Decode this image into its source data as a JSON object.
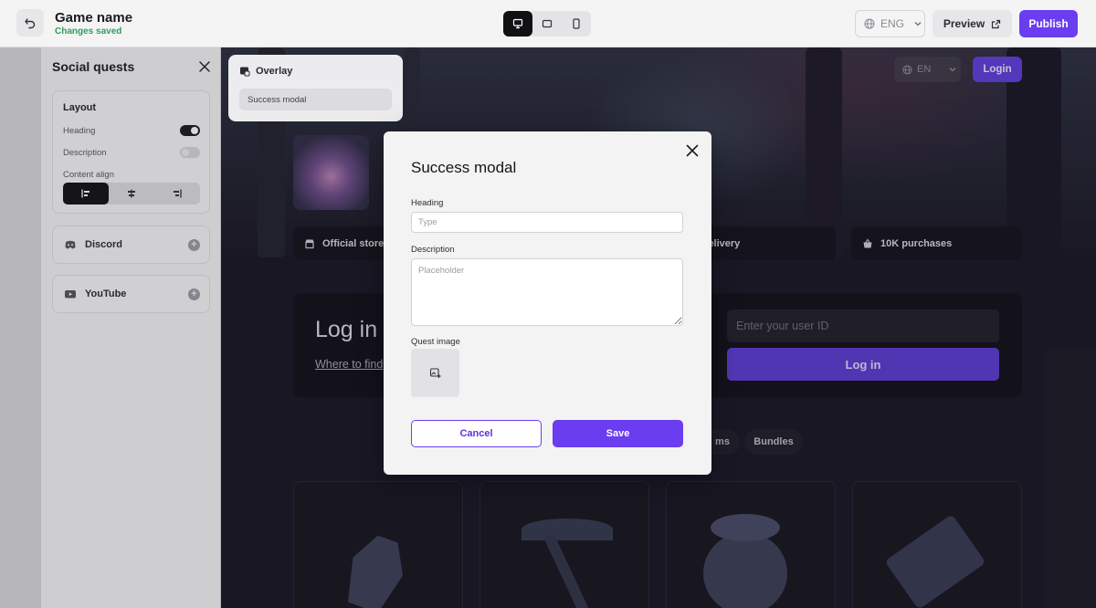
{
  "topbar": {
    "game_name": "Game name",
    "save_status": "Changes saved",
    "devices": [
      "desktop-icon",
      "tablet-icon",
      "mobile-icon"
    ],
    "active_device": "desktop",
    "language": "ENG",
    "preview_label": "Preview",
    "publish_label": "Publish"
  },
  "sidebar": {
    "title": "Social quests",
    "layout": {
      "title": "Layout",
      "heading_label": "Heading",
      "heading_enabled": true,
      "description_label": "Description",
      "description_enabled": false,
      "content_align_label": "Content align",
      "align_options": [
        "align-left-icon",
        "align-center-icon",
        "align-right-icon"
      ],
      "align_selected": "left"
    },
    "socials": [
      {
        "label": "Discord",
        "icon": "discord-icon"
      },
      {
        "label": "YouTube",
        "icon": "youtube-icon"
      }
    ]
  },
  "breadcrumb": {
    "title": "Overlay",
    "item": "Success modal"
  },
  "page": {
    "language": "EN",
    "login_label": "Login",
    "stats": [
      "Official store",
      "t delivery",
      "10K purchases"
    ],
    "login_title": "Log in",
    "login_link": "Where to find",
    "user_id_placeholder": "Enter your user ID",
    "login_button": "Log in",
    "chips": [
      "ms",
      "Bundles"
    ]
  },
  "modal": {
    "title": "Success modal",
    "heading_label": "Heading",
    "heading_placeholder": "Type",
    "description_label": "Description",
    "description_placeholder": "Placeholder",
    "image_label": "Quest image",
    "cancel_label": "Cancel",
    "save_label": "Save"
  },
  "colors": {
    "accent": "#6a3df0",
    "saved_status": "#2f9e5b",
    "page_background": "#1c1a26"
  }
}
